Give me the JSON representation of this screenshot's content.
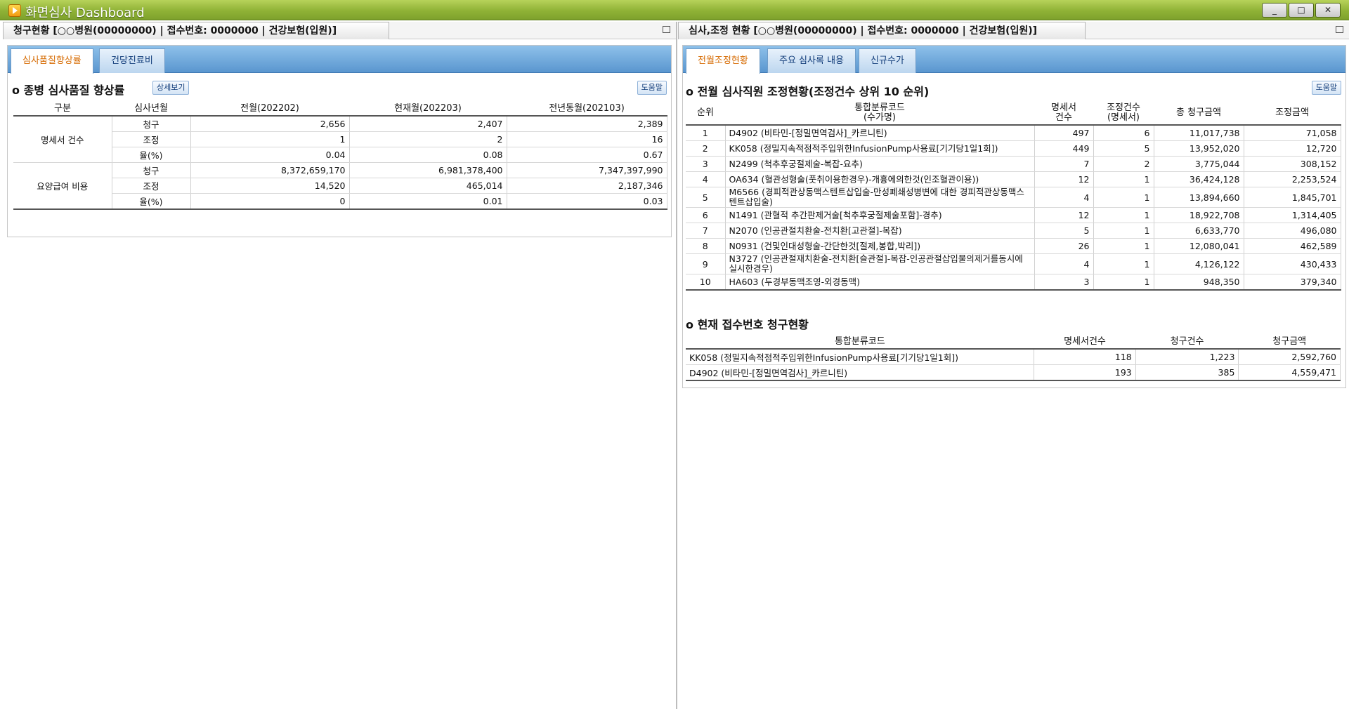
{
  "window": {
    "title": "화면심사 Dashboard",
    "buttons": {
      "minimize": "_",
      "maximize": "□",
      "close": "✕"
    }
  },
  "left_pane": {
    "header": "청구현황  [○○병원(00000000) | 접수번호:  0000000 | 건강보험(입원)]",
    "tabs": [
      "심사품질향상률",
      "건당진료비"
    ],
    "section_title": "종병 심사품질 향상률",
    "detail_button": "상세보기",
    "help_button": "도움말",
    "table": {
      "columns": [
        "구분",
        "심사년월",
        "전월(202202)",
        "현재월(202203)",
        "전년동월(202103)"
      ],
      "groups": [
        {
          "name": "명세서 건수",
          "rows": [
            {
              "label": "청구",
              "prev": "2,656",
              "cur": "2,407",
              "last_year": "2,389"
            },
            {
              "label": "조정",
              "prev": "1",
              "cur": "2",
              "last_year": "16"
            },
            {
              "label": "율(%)",
              "prev": "0.04",
              "cur": "0.08",
              "last_year": "0.67"
            }
          ]
        },
        {
          "name": "요양급여 비용",
          "rows": [
            {
              "label": "청구",
              "prev": "8,372,659,170",
              "cur": "6,981,378,400",
              "last_year": "7,347,397,990"
            },
            {
              "label": "조정",
              "prev": "14,520",
              "cur": "465,014",
              "last_year": "2,187,346"
            },
            {
              "label": "율(%)",
              "prev": "0",
              "cur": "0.01",
              "last_year": "0.03"
            }
          ]
        }
      ]
    }
  },
  "right_pane": {
    "header": "심사,조정 현황 [○○병원(00000000) | 접수번호:  0000000 | 건강보험(입원)]",
    "tabs": [
      "전월조정현황",
      "주요 심사록 내용",
      "신규수가"
    ],
    "section1_title": "전월 심사직원 조정현황(조정건수 상위 10 순위)",
    "help_button": "도움말",
    "table1": {
      "columns": [
        "순위",
        "통합분류코드\n(수가명)",
        "명세서\n건수",
        "조정건수\n(명세서)",
        "총 청구금액",
        "조정금액"
      ],
      "rows": [
        {
          "rank": "1",
          "code": "D4902 (비타민-[정밀면역검사]_카르니틴)",
          "count": "497",
          "adj": "6",
          "claim": "11,017,738",
          "amount": "71,058"
        },
        {
          "rank": "2",
          "code": "KK058 (정밀지속적점적주입위한InfusionPump사용료[기기당1일1회])",
          "count": "449",
          "adj": "5",
          "claim": "13,952,020",
          "amount": "12,720"
        },
        {
          "rank": "3",
          "code": "N2499 (척추후궁절제술-복잡-요추)",
          "count": "7",
          "adj": "2",
          "claim": "3,775,044",
          "amount": "308,152"
        },
        {
          "rank": "4",
          "code": "OA634 (혈관성형술(풋취이용한경우)-개흉에의한것(인조혈관이용))",
          "count": "12",
          "adj": "1",
          "claim": "36,424,128",
          "amount": "2,253,524"
        },
        {
          "rank": "5",
          "code": "M6566 (경피적관상동맥스텐트삽입술-만성폐쇄성병변에 대한 경피적관상동맥스텐트삽입술)",
          "count": "4",
          "adj": "1",
          "claim": "13,894,660",
          "amount": "1,845,701"
        },
        {
          "rank": "6",
          "code": "N1491 (관혈적 추간판제거술[척추후궁절제술포함]-경추)",
          "count": "12",
          "adj": "1",
          "claim": "18,922,708",
          "amount": "1,314,405"
        },
        {
          "rank": "7",
          "code": "N2070 (인공관절치환술-전치환[고관절]-복잡)",
          "count": "5",
          "adj": "1",
          "claim": "6,633,770",
          "amount": "496,080"
        },
        {
          "rank": "8",
          "code": "N0931 (건및인대성형술-간단한것[절제,봉합,박리])",
          "count": "26",
          "adj": "1",
          "claim": "12,080,041",
          "amount": "462,589"
        },
        {
          "rank": "9",
          "code": "N3727 (인공관절재치환술-전치환[슬관절]-복잡-인공관절삽입물의제거를동시에실시한경우)",
          "count": "4",
          "adj": "1",
          "claim": "4,126,122",
          "amount": "430,433"
        },
        {
          "rank": "10",
          "code": "HA603 (두경부동맥조영-외경동맥)",
          "count": "3",
          "adj": "1",
          "claim": "948,350",
          "amount": "379,340"
        }
      ]
    },
    "section2_title": "현재 접수번호 청구현황",
    "table2": {
      "columns": [
        "통합분류코드",
        "명세서건수",
        "청구건수",
        "청구금액"
      ],
      "rows": [
        {
          "code": "KK058 (정밀지속적점적주입위한InfusionPump사용료[기기당1일1회])",
          "count": "118",
          "claims": "1,223",
          "amount": "2,592,760"
        },
        {
          "code": "D4902 (비타민-[정밀면역검사]_카르니틴)",
          "count": "193",
          "claims": "385",
          "amount": "4,559,471"
        }
      ]
    }
  }
}
